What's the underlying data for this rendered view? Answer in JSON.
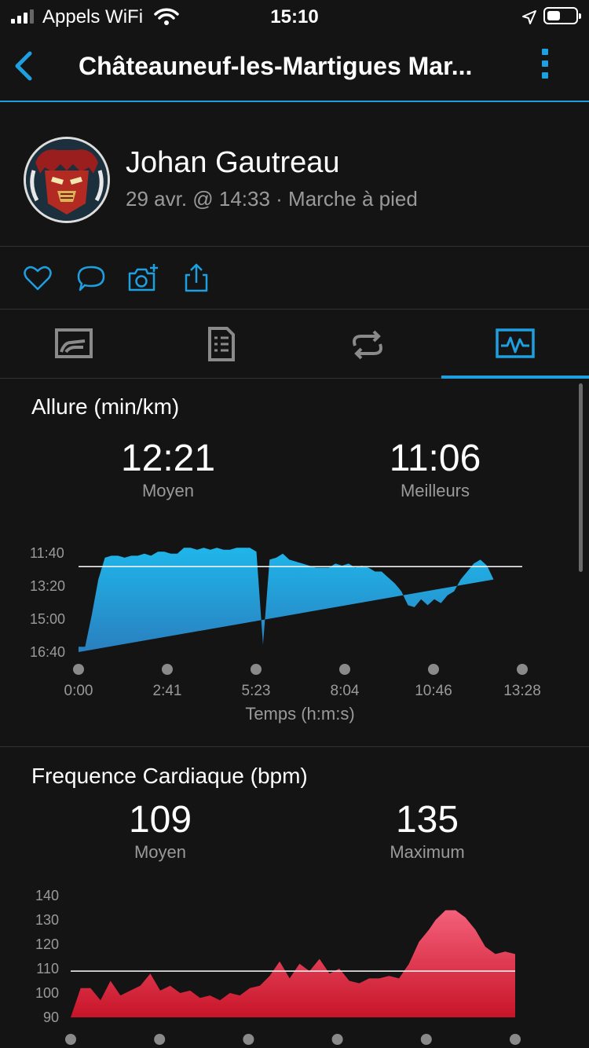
{
  "status_bar": {
    "carrier": "Appels WiFi",
    "time": "15:10"
  },
  "nav": {
    "title": "Châteauneuf-les-Martigues Mar..."
  },
  "activity": {
    "user_name": "Johan Gautreau",
    "meta": "29 avr. @ 14:33 · Marche à pied"
  },
  "tabs": [
    {
      "icon": "summary-chart-icon"
    },
    {
      "icon": "details-list-icon"
    },
    {
      "icon": "laps-loop-icon"
    },
    {
      "icon": "charts-pulse-icon",
      "active": true
    }
  ],
  "colors": {
    "accent": "#1e9fe0",
    "pace_fill": "#1fb6ea",
    "hr_fill": "#e8384f"
  },
  "pace": {
    "title": "Allure (min/km)",
    "avg_value": "12:21",
    "avg_label": "Moyen",
    "best_value": "11:06",
    "best_label": "Meilleurs",
    "x_axis_title": "Temps (h:m:s)"
  },
  "heart_rate": {
    "title": "Frequence Cardiaque (bpm)",
    "avg_value": "109",
    "avg_label": "Moyen",
    "max_value": "135",
    "max_label": "Maximum"
  },
  "chart_data": [
    {
      "type": "area",
      "title": "Allure (min/km)",
      "xlabel": "Temps (h:m:s)",
      "ylabel": "",
      "y_inverted": true,
      "x_ticks": [
        "0:00",
        "2:41",
        "5:23",
        "8:04",
        "10:46",
        "13:28"
      ],
      "y_ticks": [
        "11:40",
        "13:20",
        "15:00",
        "16:40"
      ],
      "reference_line": "12:21",
      "series": [
        {
          "x": [
            0,
            0.2,
            0.4,
            0.6,
            0.8,
            1.0,
            1.2,
            1.4,
            1.6,
            1.8,
            2.0,
            2.2,
            2.41,
            2.6,
            2.8,
            3.0,
            3.2,
            3.4,
            3.6,
            3.8,
            4.0,
            4.2,
            4.4,
            4.6,
            4.8,
            5.0,
            5.2,
            5.4,
            5.6,
            5.8,
            6.0,
            6.2,
            6.4,
            6.6,
            6.8,
            7.0,
            7.2,
            7.4,
            7.6,
            7.8,
            8.0,
            8.2,
            8.4,
            8.6,
            8.8,
            9.0,
            9.2,
            9.4,
            9.6,
            9.8,
            10.0,
            10.2,
            10.4,
            10.6,
            10.8,
            11.0,
            11.2,
            11.4,
            11.6,
            11.8,
            12.0,
            12.2,
            12.4,
            12.6,
            12.8,
            13.0,
            13.2,
            13.4
          ],
          "y_minutes": [
            16.4,
            16.4,
            14.8,
            13.0,
            11.9,
            11.8,
            11.8,
            11.9,
            11.8,
            11.8,
            11.7,
            11.8,
            11.6,
            11.6,
            11.7,
            11.7,
            11.4,
            11.4,
            11.5,
            11.4,
            11.5,
            11.4,
            11.5,
            11.5,
            11.4,
            11.4,
            11.4,
            11.6,
            16.3,
            12.0,
            11.9,
            11.7,
            12.0,
            12.1,
            12.2,
            12.3,
            12.4,
            12.4,
            12.4,
            12.2,
            12.3,
            12.2,
            12.4,
            12.3,
            12.4,
            12.6,
            12.6,
            12.9,
            13.2,
            13.6,
            14.3,
            14.4,
            14.0,
            14.3,
            14.0,
            14.2,
            13.8,
            13.6,
            13.0,
            12.6,
            12.2,
            12.0,
            12.3,
            13.0
          ]
        }
      ]
    },
    {
      "type": "area",
      "title": "Frequence Cardiaque (bpm)",
      "xlabel": "",
      "ylabel": "",
      "ylim": [
        90,
        140
      ],
      "y_ticks": [
        140,
        130,
        120,
        110,
        100,
        90
      ],
      "reference_line": 109,
      "series": [
        {
          "x": [
            0,
            0.3,
            0.6,
            0.9,
            1.2,
            1.5,
            1.8,
            2.1,
            2.4,
            2.7,
            3.0,
            3.3,
            3.6,
            3.9,
            4.2,
            4.5,
            4.8,
            5.1,
            5.4,
            5.7,
            6.0,
            6.3,
            6.6,
            6.9,
            7.2,
            7.5,
            7.8,
            8.1,
            8.4,
            8.7,
            9.0,
            9.3,
            9.6,
            9.9,
            10.2,
            10.5,
            10.8,
            11.0,
            11.3,
            11.6,
            11.9,
            12.2,
            12.5,
            12.8,
            13.1,
            13.4
          ],
          "y": [
            90,
            102,
            102,
            97,
            105,
            99,
            101,
            103,
            108,
            101,
            103,
            100,
            101,
            98,
            99,
            97,
            100,
            99,
            102,
            103,
            107,
            113,
            106,
            112,
            109,
            114,
            108,
            110,
            105,
            104,
            106,
            106,
            107,
            106,
            112,
            121,
            126,
            130,
            134,
            134,
            131,
            126,
            119,
            116,
            117,
            116
          ]
        }
      ]
    }
  ]
}
